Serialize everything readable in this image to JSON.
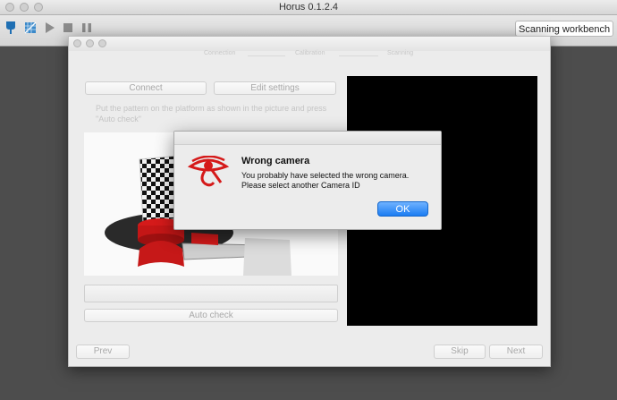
{
  "window": {
    "title": "Horus 0.1.2.4"
  },
  "toolbar": {
    "workbench": "Scanning workbench"
  },
  "wizard": {
    "steps": [
      "Connection",
      "Calibration",
      "Scanning"
    ],
    "connect_label": "Connect",
    "edit_settings_label": "Edit settings",
    "hint": "Put the pattern on the platform as shown in the picture and press \"Auto check\"",
    "auto_check_label": "Auto check",
    "prev_label": "Prev",
    "skip_label": "Skip",
    "next_label": "Next"
  },
  "alert": {
    "title": "Wrong camera",
    "message_line1": "You probably have selected the wrong camera.",
    "message_line2": "Please select another Camera ID",
    "ok_label": "OK"
  },
  "colors": {
    "accent": "#1b7cf2",
    "brand_red": "#d51a1a"
  }
}
